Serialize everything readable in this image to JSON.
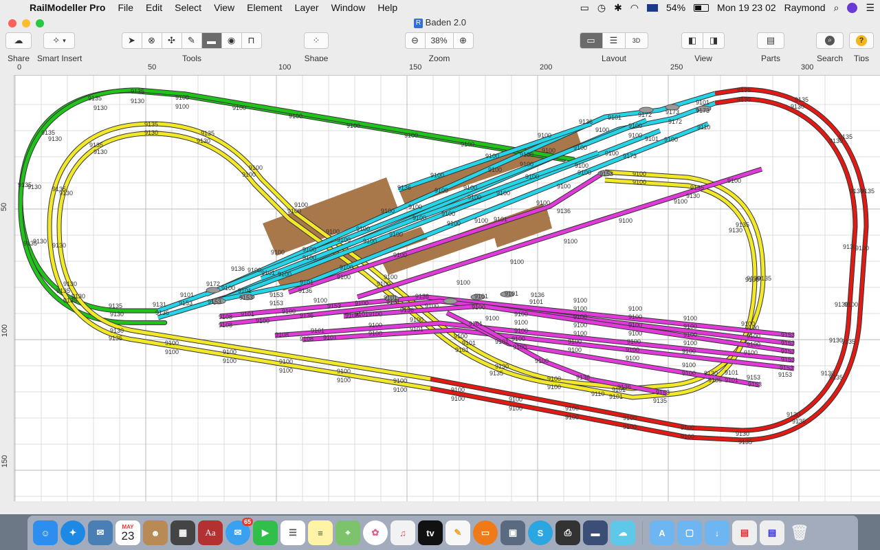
{
  "menubar": {
    "app_name": "RailModeller Pro",
    "items": [
      "File",
      "Edit",
      "Select",
      "View",
      "Element",
      "Layer",
      "Window",
      "Help"
    ],
    "battery": "54%",
    "datetime": "Mon 19 23 02",
    "user": "Raymond"
  },
  "window": {
    "title": "Baden 2.0"
  },
  "toolbar": {
    "share_label": "Share",
    "smart_insert_label": "Smart Insert",
    "tools_label": "Tools",
    "shape_label": "Shape",
    "zoom_label": "Zoom",
    "zoom_value": "38%",
    "layout_label": "Layout",
    "view_label": "View",
    "parts_label": "Parts",
    "search_label": "Search",
    "tips_label": "Tips"
  },
  "ruler": {
    "top_ticks": [
      "0",
      "50",
      "100",
      "150",
      "200",
      "250",
      "300"
    ],
    "left_ticks": [
      "50",
      "100",
      "150"
    ]
  },
  "track_labels": {
    "straight": "9100",
    "straight_alt": "9101",
    "curve_inner": "9130",
    "curve_outer": "9135",
    "switch_a": "9172",
    "switch_b": "9173",
    "switch_c": "9131",
    "bumper": "9110",
    "segment_a": "9108",
    "segment_b": "9136",
    "segment_c": "9153"
  },
  "layers": {
    "green": "#22c21c",
    "yellow": "#f2e82a",
    "red": "#e01a14",
    "cyan": "#25d4e6",
    "magenta": "#e03ad9",
    "platform": "#a8774a"
  },
  "dock": {
    "calendar_month": "MAY",
    "calendar_day": "23",
    "messages_badge": "65",
    "tv_label": "tv"
  }
}
